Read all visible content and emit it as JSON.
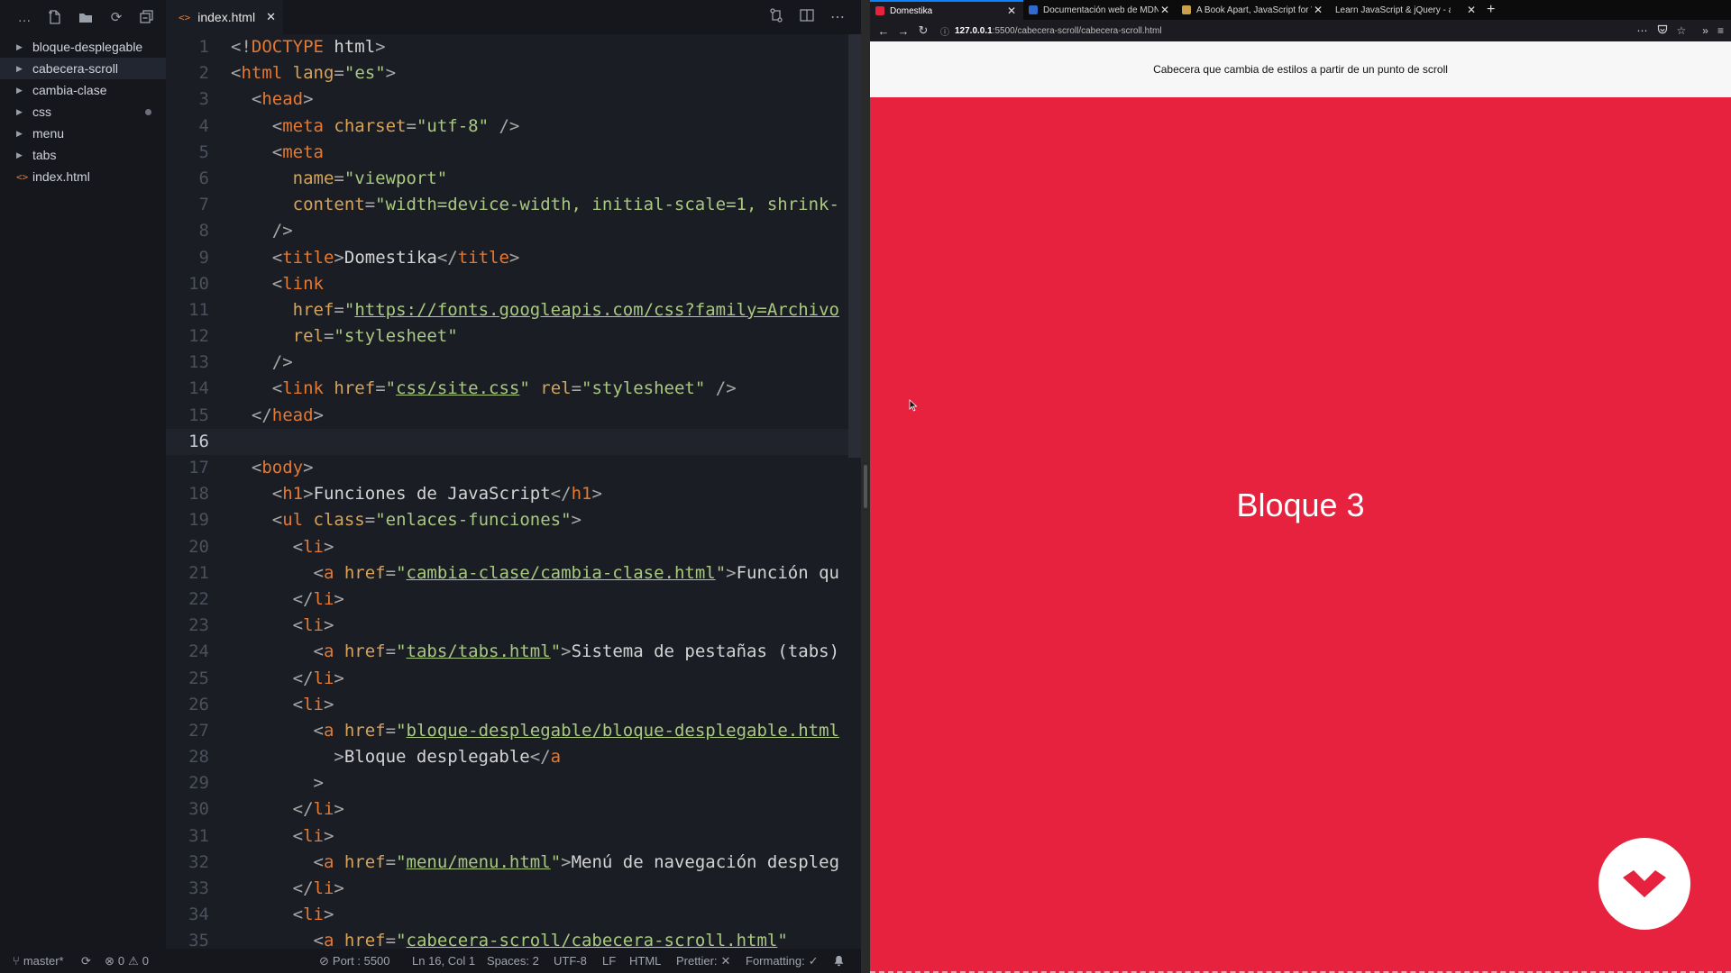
{
  "editor": {
    "sidebar": {
      "items": [
        {
          "label": "bloque-desplegable",
          "type": "folder"
        },
        {
          "label": "cabecera-scroll",
          "type": "folder",
          "active": true
        },
        {
          "label": "cambia-clase",
          "type": "folder"
        },
        {
          "label": "css",
          "type": "folder",
          "modified": true
        },
        {
          "label": "menu",
          "type": "folder"
        },
        {
          "label": "tabs",
          "type": "folder"
        },
        {
          "label": "index.html",
          "type": "file"
        }
      ]
    },
    "tab": {
      "label": "index.html",
      "close": "✕"
    },
    "code_lines": [
      [
        [
          "p",
          "<!"
        ],
        [
          "t",
          "DOCTYPE"
        ],
        [
          "x",
          " html"
        ],
        [
          "p",
          ">"
        ]
      ],
      [
        [
          "p",
          "<"
        ],
        [
          "t",
          "html"
        ],
        [
          "a",
          " lang"
        ],
        [
          "p",
          "="
        ],
        [
          "s",
          "\"es\""
        ],
        [
          "p",
          ">"
        ]
      ],
      [
        [
          "x",
          "  "
        ],
        [
          "p",
          "<"
        ],
        [
          "t",
          "head"
        ],
        [
          "p",
          ">"
        ]
      ],
      [
        [
          "x",
          "    "
        ],
        [
          "p",
          "<"
        ],
        [
          "t",
          "meta"
        ],
        [
          "a",
          " charset"
        ],
        [
          "p",
          "="
        ],
        [
          "s",
          "\"utf-8\""
        ],
        [
          "p",
          " />"
        ]
      ],
      [
        [
          "x",
          "    "
        ],
        [
          "p",
          "<"
        ],
        [
          "t",
          "meta"
        ]
      ],
      [
        [
          "x",
          "      "
        ],
        [
          "a",
          "name"
        ],
        [
          "p",
          "="
        ],
        [
          "s",
          "\"viewport\""
        ]
      ],
      [
        [
          "x",
          "      "
        ],
        [
          "a",
          "content"
        ],
        [
          "p",
          "="
        ],
        [
          "s",
          "\"width=device-width, initial-scale=1, shrink-"
        ]
      ],
      [
        [
          "x",
          "    "
        ],
        [
          "p",
          "/>"
        ]
      ],
      [
        [
          "x",
          "    "
        ],
        [
          "p",
          "<"
        ],
        [
          "t",
          "title"
        ],
        [
          "p",
          ">"
        ],
        [
          "x",
          "Domestika"
        ],
        [
          "p",
          "</"
        ],
        [
          "t",
          "title"
        ],
        [
          "p",
          ">"
        ]
      ],
      [
        [
          "x",
          "    "
        ],
        [
          "p",
          "<"
        ],
        [
          "t",
          "link"
        ]
      ],
      [
        [
          "x",
          "      "
        ],
        [
          "a",
          "href"
        ],
        [
          "p",
          "="
        ],
        [
          "s",
          "\""
        ],
        [
          "u",
          "https://fonts.googleapis.com/css?family=Archivo"
        ]
      ],
      [
        [
          "x",
          "      "
        ],
        [
          "a",
          "rel"
        ],
        [
          "p",
          "="
        ],
        [
          "s",
          "\"stylesheet\""
        ]
      ],
      [
        [
          "x",
          "    "
        ],
        [
          "p",
          "/>"
        ]
      ],
      [
        [
          "x",
          "    "
        ],
        [
          "p",
          "<"
        ],
        [
          "t",
          "link"
        ],
        [
          "a",
          " href"
        ],
        [
          "p",
          "="
        ],
        [
          "s",
          "\""
        ],
        [
          "u",
          "css/site.css"
        ],
        [
          "s",
          "\""
        ],
        [
          "a",
          " rel"
        ],
        [
          "p",
          "="
        ],
        [
          "s",
          "\"stylesheet\""
        ],
        [
          "p",
          " />"
        ]
      ],
      [
        [
          "x",
          "  "
        ],
        [
          "p",
          "</"
        ],
        [
          "t",
          "head"
        ],
        [
          "p",
          ">"
        ]
      ],
      [],
      [
        [
          "x",
          "  "
        ],
        [
          "p",
          "<"
        ],
        [
          "t",
          "body"
        ],
        [
          "p",
          ">"
        ]
      ],
      [
        [
          "x",
          "    "
        ],
        [
          "p",
          "<"
        ],
        [
          "t",
          "h1"
        ],
        [
          "p",
          ">"
        ],
        [
          "x",
          "Funciones de JavaScript"
        ],
        [
          "p",
          "</"
        ],
        [
          "t",
          "h1"
        ],
        [
          "p",
          ">"
        ]
      ],
      [
        [
          "x",
          "    "
        ],
        [
          "p",
          "<"
        ],
        [
          "t",
          "ul"
        ],
        [
          "a",
          " class"
        ],
        [
          "p",
          "="
        ],
        [
          "s",
          "\"enlaces-funciones\""
        ],
        [
          "p",
          ">"
        ]
      ],
      [
        [
          "x",
          "      "
        ],
        [
          "p",
          "<"
        ],
        [
          "t",
          "li"
        ],
        [
          "p",
          ">"
        ]
      ],
      [
        [
          "x",
          "        "
        ],
        [
          "p",
          "<"
        ],
        [
          "t",
          "a"
        ],
        [
          "a",
          " href"
        ],
        [
          "p",
          "="
        ],
        [
          "s",
          "\""
        ],
        [
          "u",
          "cambia-clase/cambia-clase.html"
        ],
        [
          "s",
          "\""
        ],
        [
          "p",
          ">"
        ],
        [
          "x",
          "Función qu"
        ]
      ],
      [
        [
          "x",
          "      "
        ],
        [
          "p",
          "</"
        ],
        [
          "t",
          "li"
        ],
        [
          "p",
          ">"
        ]
      ],
      [
        [
          "x",
          "      "
        ],
        [
          "p",
          "<"
        ],
        [
          "t",
          "li"
        ],
        [
          "p",
          ">"
        ]
      ],
      [
        [
          "x",
          "        "
        ],
        [
          "p",
          "<"
        ],
        [
          "t",
          "a"
        ],
        [
          "a",
          " href"
        ],
        [
          "p",
          "="
        ],
        [
          "s",
          "\""
        ],
        [
          "u",
          "tabs/tabs.html"
        ],
        [
          "s",
          "\""
        ],
        [
          "p",
          ">"
        ],
        [
          "x",
          "Sistema de pestañas (tabs)"
        ]
      ],
      [
        [
          "x",
          "      "
        ],
        [
          "p",
          "</"
        ],
        [
          "t",
          "li"
        ],
        [
          "p",
          ">"
        ]
      ],
      [
        [
          "x",
          "      "
        ],
        [
          "p",
          "<"
        ],
        [
          "t",
          "li"
        ],
        [
          "p",
          ">"
        ]
      ],
      [
        [
          "x",
          "        "
        ],
        [
          "p",
          "<"
        ],
        [
          "t",
          "a"
        ],
        [
          "a",
          " href"
        ],
        [
          "p",
          "="
        ],
        [
          "s",
          "\""
        ],
        [
          "u",
          "bloque-desplegable/bloque-desplegable.html"
        ]
      ],
      [
        [
          "x",
          "          "
        ],
        [
          "p",
          ">"
        ],
        [
          "x",
          "Bloque desplegable"
        ],
        [
          "p",
          "</"
        ],
        [
          "t",
          "a"
        ]
      ],
      [
        [
          "x",
          "        "
        ],
        [
          "p",
          ">"
        ]
      ],
      [
        [
          "x",
          "      "
        ],
        [
          "p",
          "</"
        ],
        [
          "t",
          "li"
        ],
        [
          "p",
          ">"
        ]
      ],
      [
        [
          "x",
          "      "
        ],
        [
          "p",
          "<"
        ],
        [
          "t",
          "li"
        ],
        [
          "p",
          ">"
        ]
      ],
      [
        [
          "x",
          "        "
        ],
        [
          "p",
          "<"
        ],
        [
          "t",
          "a"
        ],
        [
          "a",
          " href"
        ],
        [
          "p",
          "="
        ],
        [
          "s",
          "\""
        ],
        [
          "u",
          "menu/menu.html"
        ],
        [
          "s",
          "\""
        ],
        [
          "p",
          ">"
        ],
        [
          "x",
          "Menú de navegación despleg"
        ]
      ],
      [
        [
          "x",
          "      "
        ],
        [
          "p",
          "</"
        ],
        [
          "t",
          "li"
        ],
        [
          "p",
          ">"
        ]
      ],
      [
        [
          "x",
          "      "
        ],
        [
          "p",
          "<"
        ],
        [
          "t",
          "li"
        ],
        [
          "p",
          ">"
        ]
      ],
      [
        [
          "x",
          "        "
        ],
        [
          "p",
          "<"
        ],
        [
          "t",
          "a"
        ],
        [
          "a",
          " href"
        ],
        [
          "p",
          "="
        ],
        [
          "s",
          "\""
        ],
        [
          "u",
          "cabecera-scroll/cabecera-scroll.html"
        ],
        [
          "s",
          "\""
        ]
      ]
    ],
    "current_line": 16,
    "status": {
      "branch": "master*",
      "errors": "0",
      "warnings": "0",
      "port": "Port : 5500",
      "position": "Ln 16, Col 1",
      "spaces": "Spaces: 2",
      "encoding": "UTF-8",
      "eol": "LF",
      "language": "HTML",
      "prettier": "Prettier:",
      "formatting": "Formatting:"
    }
  },
  "browser": {
    "tabs": [
      {
        "label": "Domestika",
        "active": true,
        "favicon_color": "#e7223f"
      },
      {
        "label": "Documentación web de MDN",
        "favicon_color": "#2f6ad0"
      },
      {
        "label": "A Book Apart, JavaScript for W",
        "favicon_color": "#c9a14a"
      },
      {
        "label": "Learn JavaScript & jQuery - a book",
        "favicon_color": ""
      }
    ],
    "url_host": "127.0.0.1",
    "url_path": ":5500/cabecera-scroll/cabecera-scroll.html",
    "header_text": "Cabecera que cambia de estilos a partir de un punto de scroll",
    "block_title": "Bloque 3",
    "background_color": "#e7223f"
  }
}
